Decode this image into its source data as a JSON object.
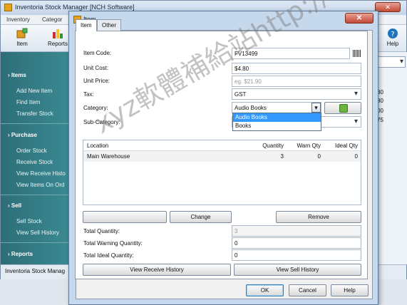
{
  "main_window": {
    "title": "Inventoria Stock Manager [NCH Software]",
    "menu": [
      "Inventory",
      "Categor"
    ],
    "toolbar": [
      {
        "label": "Item",
        "icon": "item-icon"
      },
      {
        "label": "Reports",
        "icon": "reports-icon"
      },
      {
        "label": "Help",
        "icon": "help-icon"
      }
    ],
    "sidebar": {
      "sections": [
        {
          "title": "Items",
          "items": [
            "Add New Item",
            "Find Item",
            "Transfer Stock"
          ]
        },
        {
          "title": "Purchase",
          "items": [
            "Order Stock",
            "Receive Stock",
            "View Receive Histo",
            "View Items On Ord"
          ]
        },
        {
          "title": "Sell",
          "items": [
            "Sell Stock",
            "View Sell History"
          ]
        },
        {
          "title": "Reports",
          "items": []
        }
      ]
    },
    "status_text": "Inventoria Stock Manag",
    "right_values": [
      "80",
      "80",
      "00",
      "75"
    ]
  },
  "dialog": {
    "title": "Item",
    "close_label": "✕",
    "tabs": [
      {
        "label": "Item",
        "active": true
      },
      {
        "label": "Other",
        "active": false
      }
    ],
    "fields": {
      "item_code": {
        "label": "Item Code:",
        "value": "FV13499"
      },
      "unit_cost": {
        "label": "Unit Cost:",
        "value": "$4.80"
      },
      "unit_price": {
        "label": "Unit Price:",
        "placeholder": "eg. $21.90"
      },
      "tax": {
        "label": "Tax:",
        "value": "GST"
      },
      "category": {
        "label": "Category:",
        "value": "Audio Books",
        "options": [
          "Audio Books",
          "Books"
        ]
      },
      "sub_category": {
        "label": "Sub-Category:",
        "value": ""
      }
    },
    "location_table": {
      "columns": [
        "Location",
        "Quantity",
        "Warn Qty",
        "Ideal Qty"
      ],
      "rows": [
        {
          "location": "Main Warehouse",
          "quantity": "3",
          "warn_qty": "0",
          "ideal_qty": "0"
        }
      ]
    },
    "table_buttons": {
      "change": "Change",
      "remove": "Remove"
    },
    "totals": {
      "total_quantity": {
        "label": "Total Quantity:",
        "value": "3"
      },
      "total_warning": {
        "label": "Total Warning Quantity:",
        "value": "0"
      },
      "total_ideal": {
        "label": "Total Ideal Quantity:",
        "value": "0"
      }
    },
    "history_buttons": {
      "receive": "View Receive History",
      "sell": "View Sell History"
    },
    "footer_buttons": {
      "ok": "OK",
      "cancel": "Cancel",
      "help": "Help"
    }
  },
  "watermark": "xyz軟體補給站http://31.to"
}
